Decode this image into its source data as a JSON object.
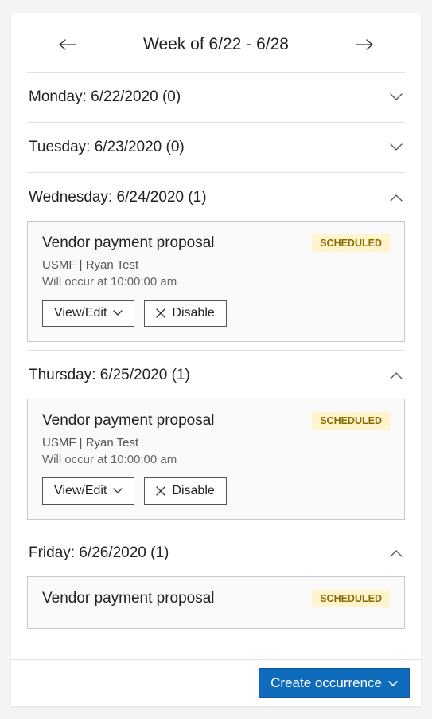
{
  "header": {
    "title": "Week of 6/22 - 6/28"
  },
  "days": {
    "monday": {
      "label": "Monday: 6/22/2020 (0)",
      "expanded": false
    },
    "tuesday": {
      "label": "Tuesday: 6/23/2020 (0)",
      "expanded": false
    },
    "wednesday": {
      "label": "Wednesday: 6/24/2020 (1)",
      "expanded": true
    },
    "thursday": {
      "label": "Thursday: 6/25/2020 (1)",
      "expanded": true
    },
    "friday": {
      "label": "Friday: 6/26/2020 (1)",
      "expanded": true
    }
  },
  "events": {
    "wednesday": {
      "title": "Vendor payment proposal",
      "status": "SCHEDULED",
      "meta": "USMF | Ryan Test",
      "time": "Will occur at 10:00:00 am"
    },
    "thursday": {
      "title": "Vendor payment proposal",
      "status": "SCHEDULED",
      "meta": "USMF | Ryan Test",
      "time": "Will occur at 10:00:00 am"
    },
    "friday": {
      "title": "Vendor payment proposal",
      "status": "SCHEDULED"
    }
  },
  "buttons": {
    "viewEdit": "View/Edit",
    "disable": "Disable",
    "createOccurrence": "Create occurrence"
  }
}
